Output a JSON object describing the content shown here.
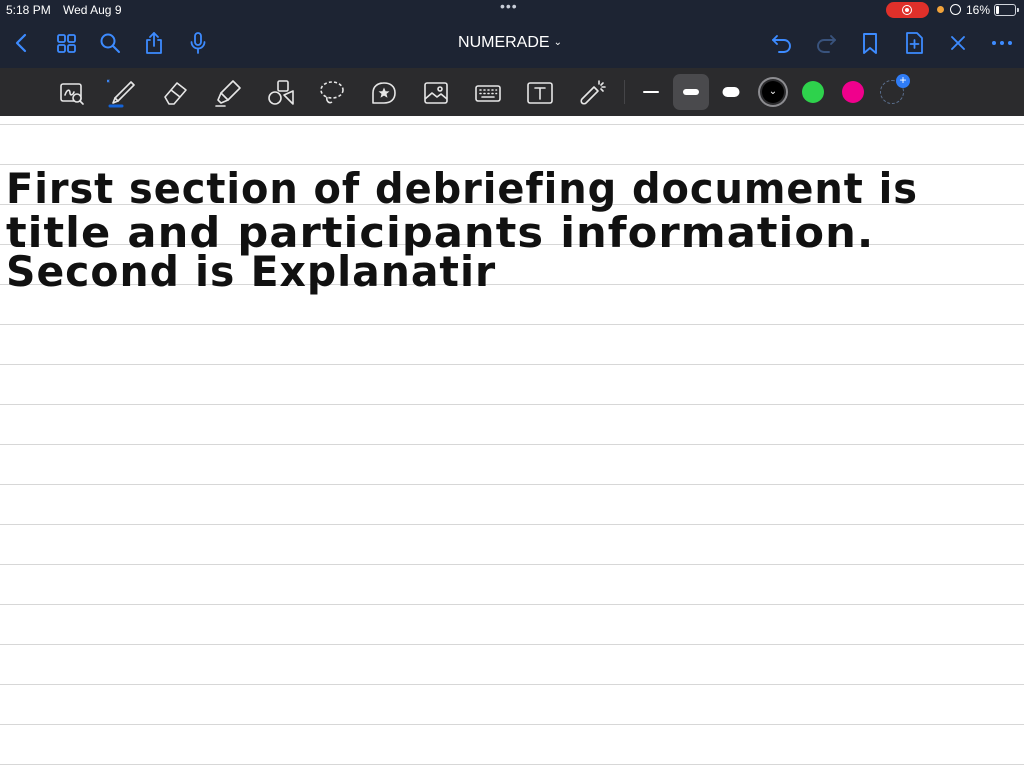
{
  "status_bar": {
    "time": "5:18 PM",
    "date": "Wed Aug 9",
    "battery_percent": "16%",
    "battery_level": 0.16,
    "recording": true
  },
  "nav_bar": {
    "title": "NUMERADE",
    "left_icons": [
      "back-icon",
      "grid-icon",
      "search-icon",
      "share-icon",
      "microphone-icon"
    ],
    "right_icons": [
      "undo-icon",
      "redo-icon",
      "bookmark-icon",
      "add-page-icon",
      "close-icon",
      "more-icon"
    ]
  },
  "toolbar": {
    "tools": [
      "zoom-window-icon",
      "pen-icon",
      "eraser-icon",
      "highlighter-icon",
      "shapes-icon",
      "lasso-icon",
      "sticker-icon",
      "image-icon",
      "keyboard-icon",
      "text-box-icon",
      "laser-pointer-icon"
    ],
    "selected_tool": "pen-icon",
    "stroke_widths": [
      "thin",
      "medium",
      "thick"
    ],
    "selected_stroke": "medium",
    "colors": [
      "#000000",
      "#2ed24c",
      "#f0008c"
    ],
    "selected_color": "#000000"
  },
  "note": {
    "lines": [
      "First section of debriefing document is",
      "title and participants information.",
      "Second is Explanatir"
    ],
    "ink_color": "#111111"
  }
}
